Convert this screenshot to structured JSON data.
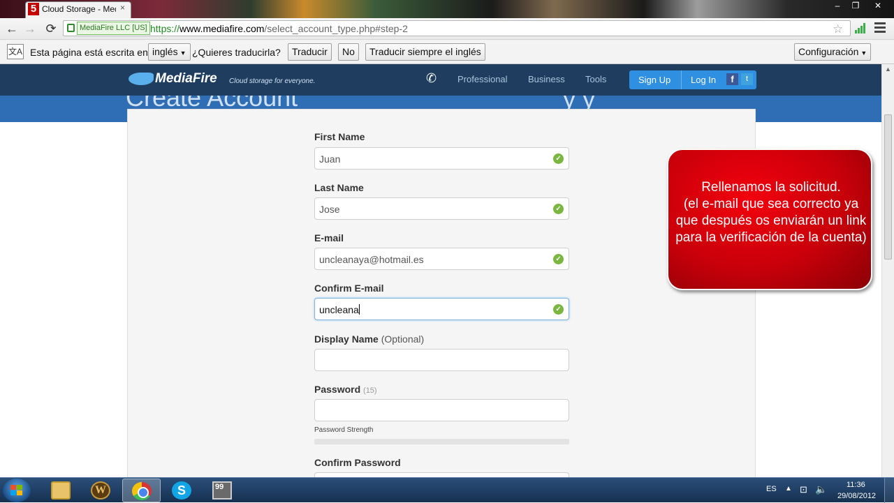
{
  "browser": {
    "tab": {
      "favicon": "5",
      "title": "Cloud Storage - MediaFire",
      "close": "×"
    },
    "window_controls": {
      "minimize": "–",
      "maximize": "❐",
      "close": "✕"
    },
    "nav": {
      "back": "←",
      "forward": "→",
      "reload": "⟳"
    },
    "address": {
      "ev_badge": "MediaFire LLC [US]",
      "scheme": "https://",
      "host": "www.mediafire.com",
      "path": "/select_account_type.php#step-2"
    },
    "star": "☆"
  },
  "translate_bar": {
    "icon": "文A",
    "message": "Esta página está escrita en",
    "language": "inglés",
    "question": "¿Quieres traducirla?",
    "translate_button": "Traducir",
    "no_button": "No",
    "always_button": "Traducir siempre el inglés",
    "settings_button": "Configuración"
  },
  "site_nav": {
    "logo": "MediaFire",
    "tagline": "Cloud storage for everyone.",
    "links": [
      "Professional",
      "Business",
      "Tools"
    ],
    "sign_up": "Sign Up",
    "log_in": "Log In",
    "facebook": "f",
    "twitter": "t"
  },
  "hero": {
    "title": "Create Account",
    "right_text": "y  y"
  },
  "form": {
    "first_name": {
      "label": "First Name",
      "value": "Juan"
    },
    "last_name": {
      "label": "Last Name",
      "value": "Jose"
    },
    "email": {
      "label": "E-mail",
      "value": "uncleanaya@hotmail.es"
    },
    "confirm_email": {
      "label": "Confirm E-mail",
      "value": "uncleana"
    },
    "display_name": {
      "label": "Display Name",
      "optional": "(Optional)",
      "value": ""
    },
    "password": {
      "label": "Password",
      "counter": "(15)",
      "value": ""
    },
    "password_strength_label": "Password Strength",
    "password_strength": 0,
    "confirm_password": {
      "label": "Confirm Password"
    },
    "valid_icon": "✓"
  },
  "callout": {
    "line1": "Rellenamos la solicitud.",
    "line2": "(el e-mail que sea correcto ya que después os enviarán un link para la verificación de la cuenta)"
  },
  "taskbar": {
    "apps": [
      "Windows Explorer",
      "World of Warcraft",
      "Google Chrome",
      "Skype",
      "Game"
    ],
    "wow_letter": "W",
    "skype_letter": "S",
    "game_label": "99",
    "tray": {
      "language": "ES",
      "time": "11:36",
      "date": "29/08/2012"
    }
  }
}
